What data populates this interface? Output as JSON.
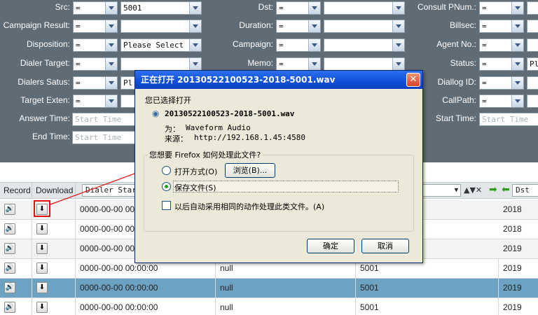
{
  "filters": {
    "src": {
      "label": "Src:",
      "op": "=",
      "value": "5001"
    },
    "dst": {
      "label": "Dst:",
      "op": "=",
      "value": ""
    },
    "consult_pnum": {
      "label": "Consult PNum.:",
      "op": "=",
      "value": ""
    },
    "campaign_result": {
      "label": "Campaign Result:",
      "op": "=",
      "value": ""
    },
    "duration": {
      "label": "Duration:",
      "op": "=",
      "value": ""
    },
    "billsec": {
      "label": "Billsec:",
      "op": "=",
      "value": ""
    },
    "disposition": {
      "label": "Disposition:",
      "op": "=",
      "value": "Please Select"
    },
    "campaign": {
      "label": "Campaign:",
      "op": "=",
      "value": ""
    },
    "agent_no": {
      "label": "Agent No.:",
      "op": "=",
      "value": ""
    },
    "dialer_target": {
      "label": "Dialer Target:",
      "op": "=",
      "value": ""
    },
    "memo": {
      "label": "Memo:",
      "op": "=",
      "value": ""
    },
    "status": {
      "label": "Status:",
      "op": "=",
      "value": "Pl"
    },
    "dialers_satus": {
      "label": "Dialers Satus:",
      "op": "=",
      "value": "Pl"
    },
    "diallog_id": {
      "label": "Diallog ID:",
      "op": "=",
      "value": ""
    },
    "target_exten": {
      "label": "Target Exten:",
      "op": "=",
      "value": ""
    },
    "callpath": {
      "label": "CallPath:",
      "op": "=",
      "value": ""
    },
    "answer_time": {
      "label": "Answer Time:",
      "placeholder": "Start Time"
    },
    "end_time": {
      "label": "End Time:",
      "placeholder": "Start Time"
    },
    "start_time": {
      "label": "Start Time:",
      "placeholder": "Start Time"
    }
  },
  "table": {
    "headers": {
      "record": "Record",
      "download": "Download",
      "col1_select": "Dialer Star",
      "col_last_select": "Dst"
    },
    "rows": [
      {
        "time": "0000-00-00 00:",
        "memo": "",
        "src": "",
        "year": "2018"
      },
      {
        "time": "0000-00-00 00:",
        "memo": "",
        "src": "",
        "year": "2018"
      },
      {
        "time": "0000-00-00 00:",
        "memo": "",
        "src": "",
        "year": "2019"
      },
      {
        "time": "0000-00-00 00:00:00",
        "memo": "null",
        "src": "5001",
        "year": "2019"
      },
      {
        "time": "0000-00-00 00:00:00",
        "memo": "null",
        "src": "5001",
        "year": "2019"
      },
      {
        "time": "0000-00-00 00:00:00",
        "memo": "null",
        "src": "5001",
        "year": "2019"
      }
    ]
  },
  "dialog": {
    "title": "正在打开 20130522100523-2018-5001.wav",
    "chosen_label": "您已选择打开",
    "filename": "20130522100523-2018-5001.wav",
    "type_label": "为：",
    "type_value": "Waveform Audio",
    "source_label": "来源：",
    "source_value": "http://192.168.1.45:4580",
    "question": "您想要 Firefox 如何处理此文件?",
    "open_with": "打开方式(O)",
    "browse": "浏览(B)...",
    "save_file": "保存文件(S)",
    "auto_same": "以后自动采用相同的动作处理此类文件。(A)",
    "ok": "确定",
    "cancel": "取消",
    "close": "✕"
  },
  "icons": {
    "speaker": "speaker-icon",
    "download": "download-arrow-icon",
    "file": "audio-file-icon"
  },
  "colors": {
    "panel": "#5f6b75",
    "selected_row": "#6da2c3",
    "title_bar": "#0f4fd6",
    "annotation": "#e01010"
  }
}
